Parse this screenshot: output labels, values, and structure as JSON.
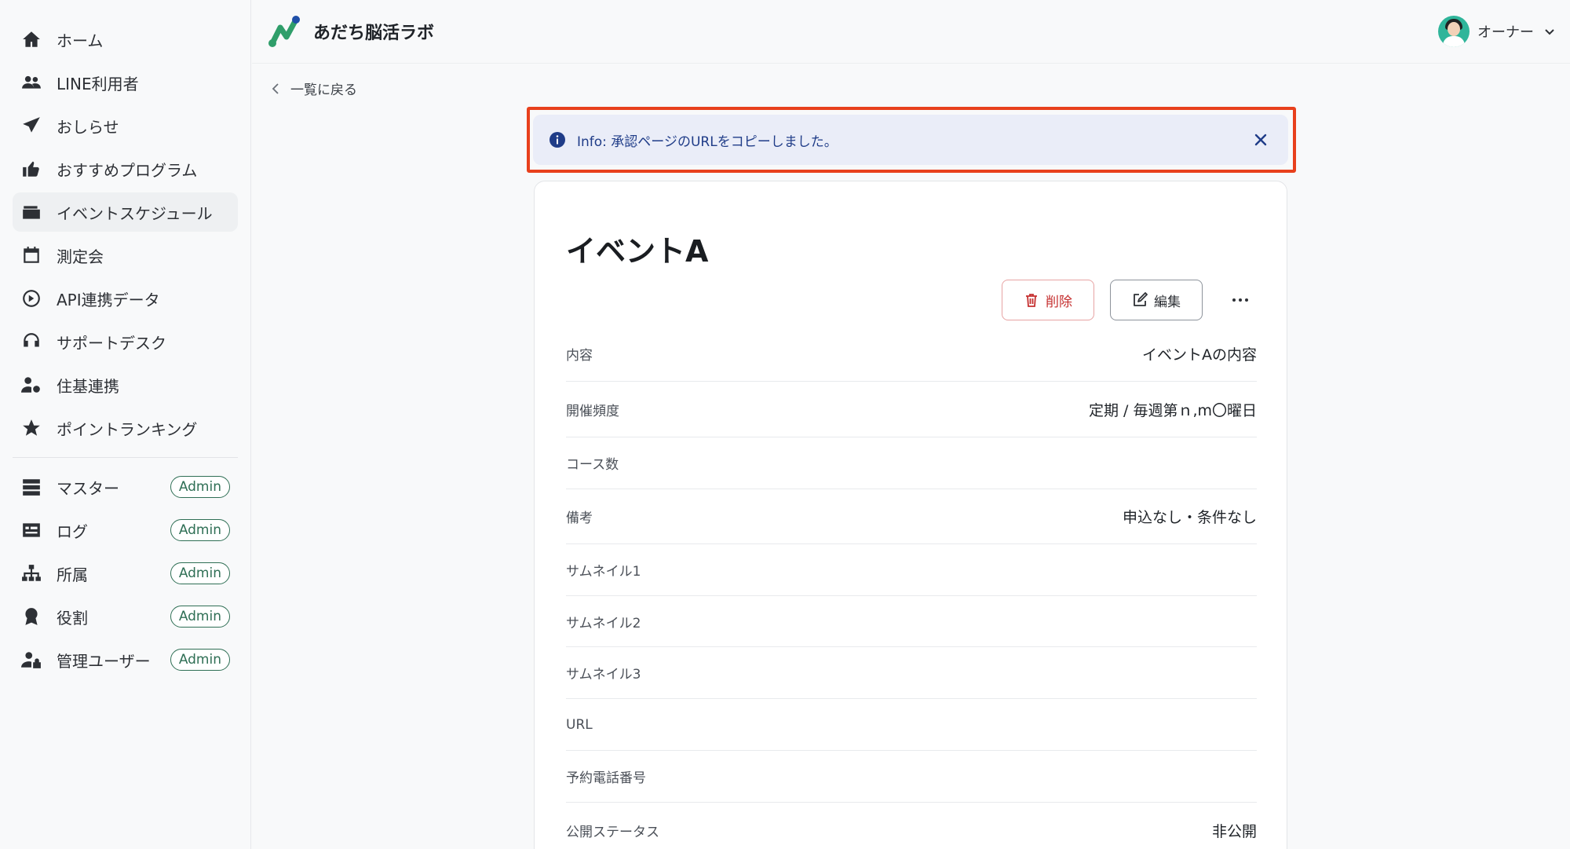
{
  "sidebar": {
    "items": [
      {
        "label": "ホーム",
        "icon": "home-icon"
      },
      {
        "label": "LINE利用者",
        "icon": "users-icon"
      },
      {
        "label": "おしらせ",
        "icon": "send-icon"
      },
      {
        "label": "おすすめプログラム",
        "icon": "thumbs-up-icon"
      },
      {
        "label": "イベントスケジュール",
        "icon": "wallet-icon"
      },
      {
        "label": "測定会",
        "icon": "calendar-icon"
      },
      {
        "label": "API連携データ",
        "icon": "api-icon"
      },
      {
        "label": "サポートデスク",
        "icon": "headset-icon"
      },
      {
        "label": "住基連携",
        "icon": "user-gear-icon"
      },
      {
        "label": "ポイントランキング",
        "icon": "star-icon"
      }
    ],
    "admin_items": [
      {
        "label": "マスター",
        "icon": "database-icon",
        "badge": "Admin"
      },
      {
        "label": "ログ",
        "icon": "log-icon",
        "badge": "Admin"
      },
      {
        "label": "所属",
        "icon": "org-icon",
        "badge": "Admin"
      },
      {
        "label": "役割",
        "icon": "award-icon",
        "badge": "Admin"
      },
      {
        "label": "管理ユーザー",
        "icon": "user-lock-icon",
        "badge": "Admin"
      }
    ]
  },
  "header": {
    "brand_name": "あだち脳活ラボ",
    "user_name": "オーナー"
  },
  "back_link": "一覧に戻る",
  "alert": {
    "text": "Info: 承認ページのURLをコピーしました。"
  },
  "event": {
    "title": "イベントA",
    "delete_label": "削除",
    "edit_label": "編集",
    "rows": [
      {
        "label": "内容",
        "value": "イベントAの内容"
      },
      {
        "label": "開催頻度",
        "value": "定期 / 毎週第ｎ,m〇曜日"
      },
      {
        "label": "コース数",
        "value": ""
      },
      {
        "label": "備考",
        "value": "申込なし・条件なし"
      },
      {
        "label": "サムネイル1",
        "value": ""
      },
      {
        "label": "サムネイル2",
        "value": ""
      },
      {
        "label": "サムネイル3",
        "value": ""
      },
      {
        "label": "URL",
        "value": ""
      },
      {
        "label": "予約電話番号",
        "value": ""
      },
      {
        "label": "公開ステータス",
        "value": "非公開"
      }
    ]
  },
  "colors": {
    "accent_green": "#2f6f55",
    "alert_bg": "#eaedf8",
    "alert_text": "#1f3c88",
    "highlight_red": "#e8401c",
    "delete_red": "#c53030"
  }
}
